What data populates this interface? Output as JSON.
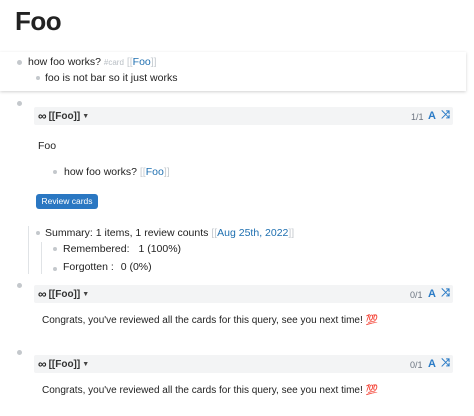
{
  "page": {
    "title": "Foo"
  },
  "card_block": {
    "question": "how foo works?",
    "tag": "#card",
    "ref_open": "[[",
    "ref": "Foo",
    "ref_close": "]]",
    "answer": "foo is not bar so it just works"
  },
  "query1": {
    "label": "[[Foo]]",
    "count": "1/1",
    "result_page": "Foo",
    "result_item": "how foo works?",
    "ref_open": "[[",
    "ref": "Foo",
    "ref_close": "]]",
    "review_button": "Review cards"
  },
  "summary": {
    "text": "Summary: 1 items, 1 review counts",
    "date_open": "[[",
    "date": "Aug 25th, 2022",
    "date_close": "]]",
    "remembered_label": "Remembered:",
    "remembered_value": "1 (100%)",
    "forgotten_label": "Forgotten :",
    "forgotten_value": "0 (0%)"
  },
  "query2": {
    "label": "[[Foo]]",
    "count": "0/1",
    "message": "Congrats, you've reviewed all the cards for this query, see you next time! 💯"
  },
  "query3": {
    "label": "[[Foo]]",
    "count": "0/1",
    "message": "Congrats, you've reviewed all the cards for this query, see you next time! 💯"
  },
  "icons": {
    "infinity": "∞",
    "caret": "▼",
    "font_toggle": "A",
    "shuffle": "⤨"
  }
}
